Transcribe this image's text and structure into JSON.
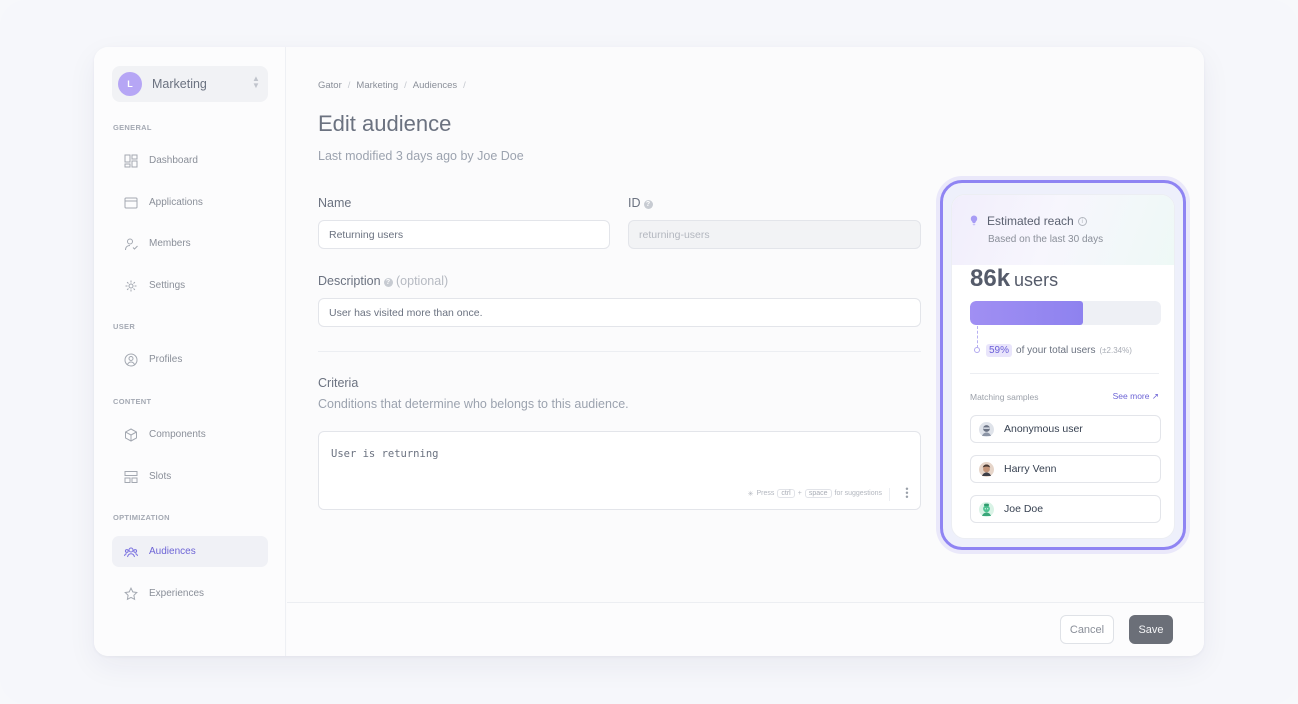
{
  "workspace": {
    "initial": "L",
    "name": "Marketing"
  },
  "sidebar": {
    "sections": [
      {
        "label": "GENERAL"
      },
      {
        "label": "USER"
      },
      {
        "label": "CONTENT"
      },
      {
        "label": "OPTIMIZATION"
      }
    ],
    "items": [
      {
        "label": "Dashboard",
        "icon": "dashboard-icon"
      },
      {
        "label": "Applications",
        "icon": "applications-icon"
      },
      {
        "label": "Members",
        "icon": "members-icon"
      },
      {
        "label": "Settings",
        "icon": "settings-icon"
      },
      {
        "label": "Profiles",
        "icon": "profile-icon"
      },
      {
        "label": "Components",
        "icon": "cube-icon"
      },
      {
        "label": "Slots",
        "icon": "slots-icon"
      },
      {
        "label": "Audiences",
        "icon": "audiences-icon",
        "active": true
      },
      {
        "label": "Experiences",
        "icon": "star-icon"
      }
    ]
  },
  "breadcrumb": [
    "Gator",
    "Marketing",
    "Audiences"
  ],
  "page": {
    "title": "Edit audience",
    "subtitle": "Last modified 3 days ago by Joe Doe"
  },
  "form": {
    "name_label": "Name",
    "name_value": "Returning users",
    "id_label": "ID",
    "id_value": "returning-users",
    "description_label": "Description",
    "description_optional": "(optional)",
    "description_value": "User has visited more than once.",
    "criteria_title": "Criteria",
    "criteria_sub": "Conditions that determine who belongs to this audience.",
    "criteria_value": "User is returning",
    "hint_press": "Press",
    "hint_key1": "ctrl",
    "hint_plus": "+",
    "hint_key2": "space",
    "hint_suffix": "for suggestions"
  },
  "footer": {
    "cancel": "Cancel",
    "save": "Save"
  },
  "reach": {
    "title": "Estimated reach",
    "subtitle": "Based on the last 30 days",
    "count": "86k",
    "unit": "users",
    "percent_label": "59%",
    "percent_value": 0.59,
    "percent_text": "of your total users",
    "percent_note": "(±2.34%)",
    "samples_label": "Matching samples",
    "see_more": "See more",
    "samples": [
      {
        "name": "Anonymous user",
        "avatar": "anonymous-avatar"
      },
      {
        "name": "Harry Venn",
        "avatar": "harry-avatar"
      },
      {
        "name": "Joe Doe",
        "avatar": "joe-avatar"
      }
    ]
  },
  "colors": {
    "accent": "#8f84f3",
    "accent_text": "#6d64d6",
    "save_button": "#6b6f78"
  }
}
